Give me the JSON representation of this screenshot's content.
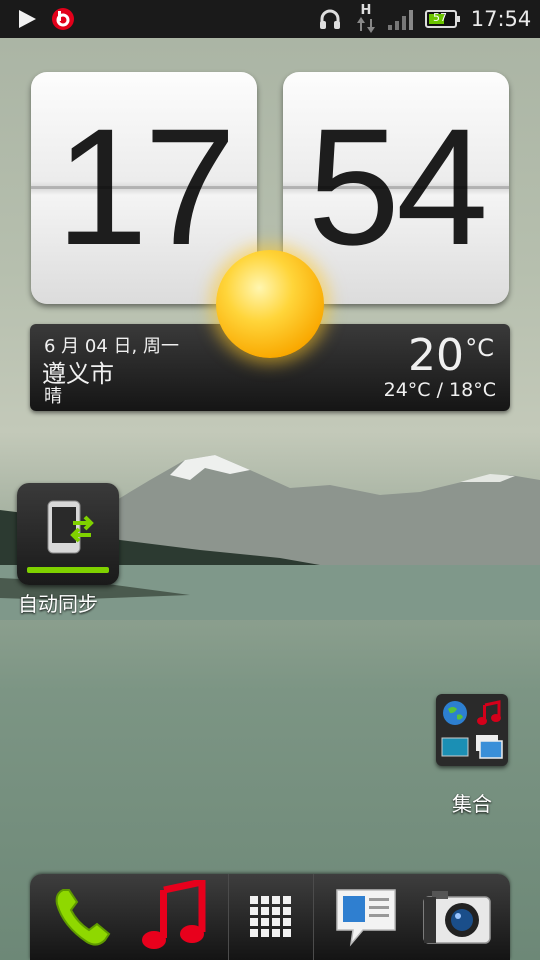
{
  "status_bar": {
    "time": "17:54",
    "battery_level": "57",
    "network_type": "H",
    "icons": [
      "play-icon",
      "beats-icon",
      "headset-icon",
      "data-transfer-icon",
      "signal-icon",
      "battery-icon"
    ]
  },
  "clock": {
    "hour": "17",
    "minute": "54"
  },
  "weather": {
    "date": "6 月 04 日, 周一",
    "city": "遵义市",
    "condition": "晴",
    "temperature": "20",
    "temperature_unit": "°C",
    "range": "24°C / 18°C",
    "icon": "sun-icon"
  },
  "widgets": {
    "sync": {
      "label": "自动同步",
      "icon": "phone-sync-icon"
    },
    "folder": {
      "label": "集合",
      "icons": [
        "globe-icon",
        "music-note-icon",
        "video-icon",
        "gallery-icon"
      ]
    }
  },
  "dock": {
    "items": [
      "phone-icon",
      "music-icon",
      "app-grid-icon",
      "messages-icon",
      "camera-icon"
    ]
  },
  "colors": {
    "accent_green": "#7fd100",
    "status_bar": "#1a1a1a",
    "music_red": "#d4001a"
  }
}
